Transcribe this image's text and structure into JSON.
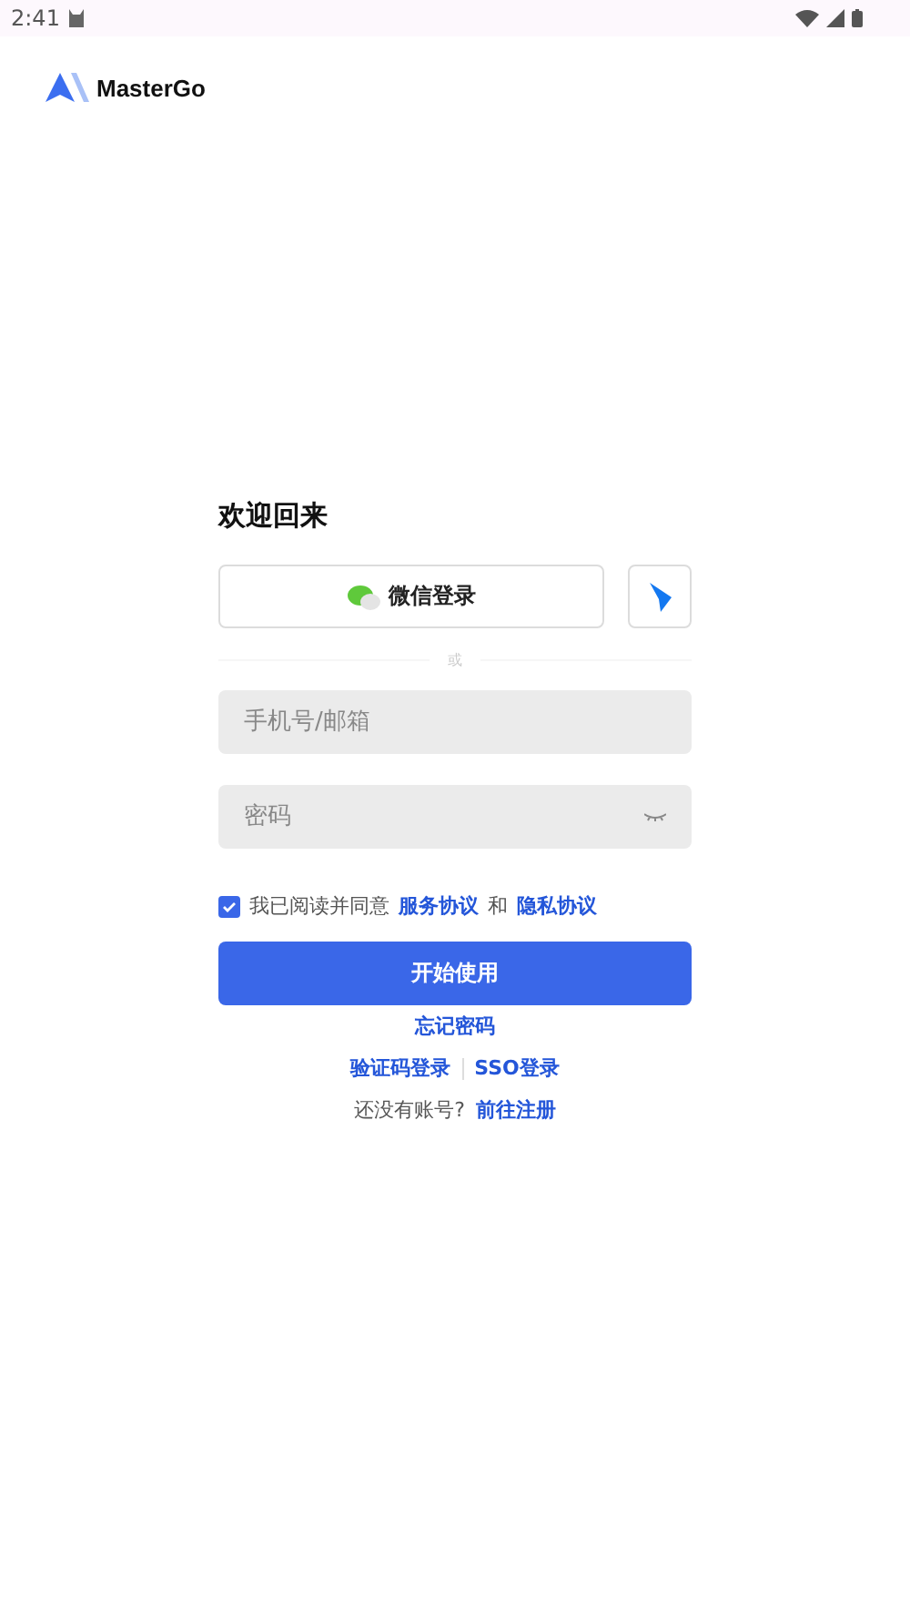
{
  "status_bar": {
    "time": "2:41"
  },
  "brand": {
    "name": "MasterGo"
  },
  "title": "欢迎回来",
  "social_login": {
    "wechat_label": "微信登录"
  },
  "divider": "或",
  "fields": [
    {
      "kind": "text",
      "placeholder": "手机号/邮箱"
    },
    {
      "kind": "password",
      "placeholder": "密码"
    }
  ],
  "agreement": {
    "checked": true,
    "prefix": "我已阅读并同意",
    "terms": "服务协议",
    "joiner": "和",
    "privacy": "隐私协议"
  },
  "submit": "开始使用",
  "forgot": "忘记密码",
  "alt_logins": [
    "验证码登录",
    "SSO登录"
  ],
  "signup": {
    "prompt": "还没有账号?",
    "link": "前往注册"
  }
}
